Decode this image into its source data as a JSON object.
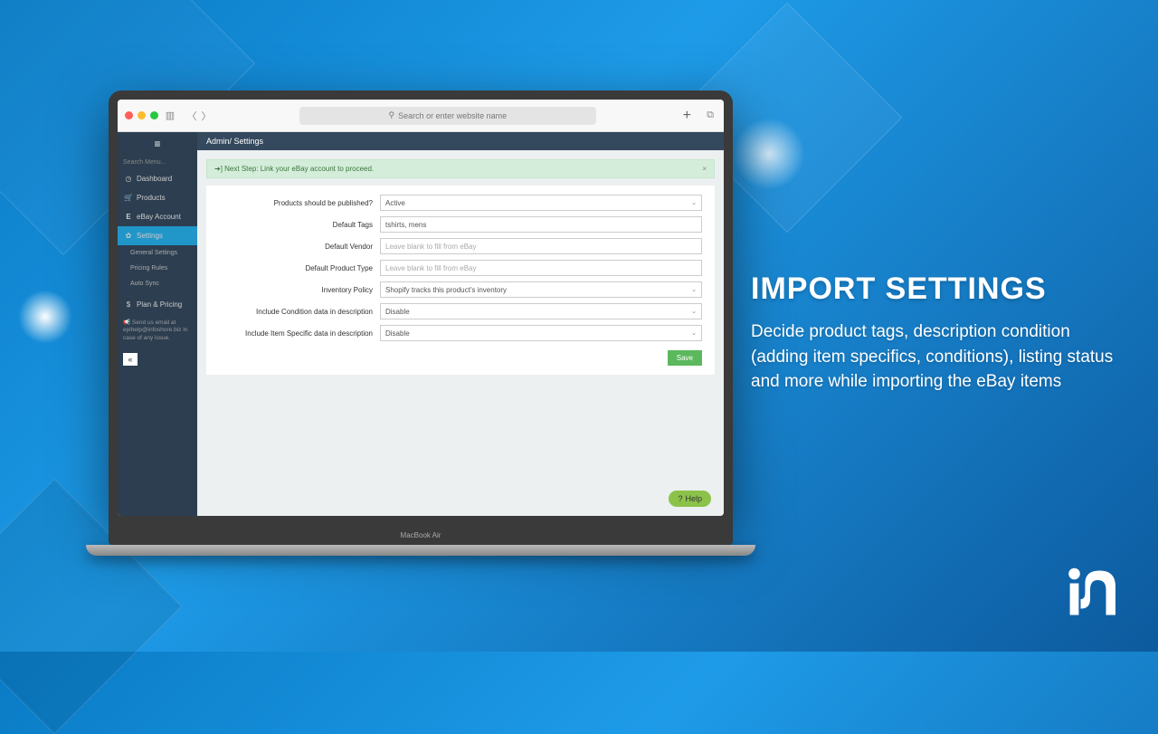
{
  "browser": {
    "search_placeholder": "Search or enter website name"
  },
  "sidebar": {
    "search_placeholder": "Search Menu...",
    "items": [
      {
        "icon": "⚙",
        "label": "Dashboard"
      },
      {
        "icon": "🛒",
        "label": "Products"
      },
      {
        "icon": "E",
        "label": "eBay Account"
      },
      {
        "icon": "✿",
        "label": "Settings"
      }
    ],
    "sub_items": [
      "General Settings",
      "Pricing Rules",
      "Auto Sync"
    ],
    "plan_item": {
      "icon": "$",
      "label": "Plan & Pricing"
    },
    "support": "Send us email at epihelp@infoshore.biz in case of any issue."
  },
  "breadcrumb": {
    "root": "Admin",
    "current": "Settings"
  },
  "alert": {
    "text": "Next Step: Link your eBay account to proceed."
  },
  "form": {
    "rows": [
      {
        "label": "Products should be published?",
        "value": "Active",
        "type": "select"
      },
      {
        "label": "Default Tags",
        "value": "tshirts, mens",
        "type": "text"
      },
      {
        "label": "Default Vendor",
        "value": "Leave blank to fill from eBay",
        "type": "placeholder"
      },
      {
        "label": "Default Product Type",
        "value": "Leave blank to fill from eBay",
        "type": "placeholder"
      },
      {
        "label": "Inventory Policy",
        "value": "Shopify tracks this product's inventory",
        "type": "select"
      },
      {
        "label": "Include Condition data in description",
        "value": "Disable",
        "type": "select"
      },
      {
        "label": "Include Item Specific data in description",
        "value": "Disable",
        "type": "select"
      }
    ],
    "save": "Save"
  },
  "help": "Help",
  "laptop_model": "MacBook Air",
  "marketing": {
    "title": "IMPORT SETTINGS",
    "body": "Decide product tags, description condition (adding item specifics, conditions), listing status and more while importing the eBay items"
  }
}
